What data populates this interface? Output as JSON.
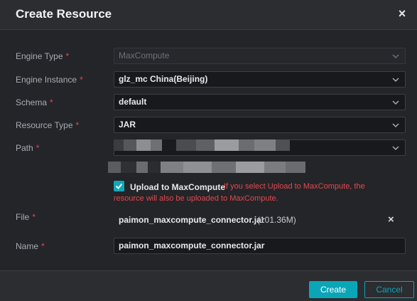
{
  "dialog": {
    "title": "Create Resource",
    "close_symbol": "×"
  },
  "fields": {
    "engine_type": {
      "label": "Engine Type",
      "value": "MaxCompute",
      "required": "*"
    },
    "engine_instance": {
      "label": "Engine Instance",
      "value": "glz_mc China(Beijing)",
      "required": "*"
    },
    "schema": {
      "label": "Schema",
      "value": "default",
      "required": "*"
    },
    "resource_type": {
      "label": "Resource Type",
      "value": "JAR",
      "required": "*"
    },
    "path": {
      "label": "Path",
      "required": "*"
    },
    "file": {
      "label": "File",
      "required": "*",
      "name": "paimon_maxcompute_connector.jar",
      "size": "(101.36M)",
      "remove_symbol": "×"
    },
    "name": {
      "label": "Name",
      "required": "*",
      "value": "paimon_maxcompute_connector.jar"
    }
  },
  "upload": {
    "label": "Upload to MaxCompute",
    "hint_line1": "If you select Upload to MaxCompute, the",
    "hint_line2": "resource will also be uploaded to MaxCompute."
  },
  "footer": {
    "create_label": "Create",
    "cancel_label": "Cancel"
  },
  "colors": {
    "accent": "#0aa6b7",
    "required": "#e5484d",
    "background": "#232529"
  }
}
